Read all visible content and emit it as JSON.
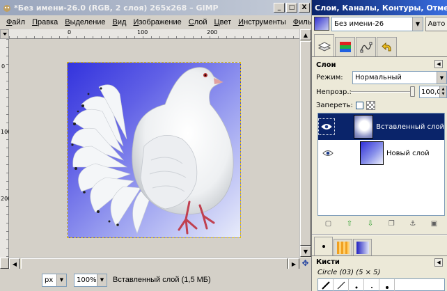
{
  "gimp_window": {
    "title": "*Без имени-26.0 (RGB, 2 слоя) 265x268 – GIMP",
    "window_buttons": [
      "_",
      "□",
      "X"
    ],
    "menu": [
      "Файл",
      "Правка",
      "Выделение",
      "Вид",
      "Изображение",
      "Слой",
      "Цвет",
      "Инструменты",
      "Фильт"
    ],
    "ruler_h_labels": [
      "0",
      "100",
      "200"
    ],
    "ruler_v_labels": [
      "0",
      "100",
      "200"
    ]
  },
  "statusbar": {
    "unit": "px",
    "zoom": "100%",
    "info": "Вставленный слой (1,5 МБ)"
  },
  "dock": {
    "title": "Слои, Каналы, Контуры, Отме...",
    "image_name": "Без имени-26",
    "auto_label": "Авто",
    "panel_title": "Слои",
    "mode_label": "Режим:",
    "mode_value": "Нормальный",
    "opacity_label": "Непрозр.:",
    "opacity_value": "100,0",
    "opacity_fraction": 1.0,
    "lock_label": "Запереть:",
    "layers": [
      {
        "name": "Вставленный слой",
        "visible": true,
        "selected": true
      },
      {
        "name": "Новый слой",
        "visible": true,
        "selected": false
      }
    ],
    "brushes_title": "Кисти",
    "brush_name": "Circle (03) (5 × 5)"
  },
  "colors": {
    "titlebar_active": "#0a246a",
    "selection": "#0a246a",
    "face": "#d4d0c8",
    "image_blue": "#3333dd"
  }
}
